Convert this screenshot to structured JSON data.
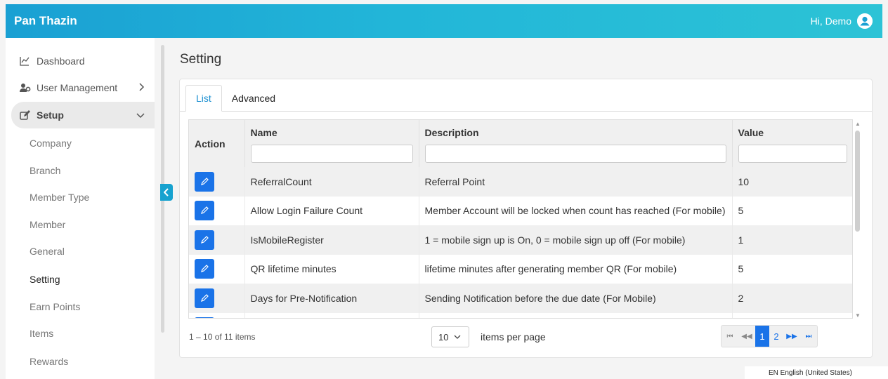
{
  "header": {
    "brand": "Pan Thazin",
    "greeting": "Hi, Demo"
  },
  "sidebar": {
    "items": [
      {
        "label": "Dashboard",
        "icon": "chart-line-icon"
      },
      {
        "label": "User Management",
        "icon": "users-cog-icon"
      },
      {
        "label": "Setup",
        "icon": "edit-icon"
      }
    ],
    "sub_items": [
      "Company",
      "Branch",
      "Member Type",
      "Member",
      "General",
      "Setting",
      "Earn Points",
      "Items",
      "Rewards"
    ],
    "active_sub": "Setting"
  },
  "page": {
    "title": "Setting"
  },
  "tabs": [
    "List",
    "Advanced"
  ],
  "grid": {
    "columns": [
      "Action",
      "Name",
      "Description",
      "Value"
    ],
    "rows": [
      {
        "name": "ReferralCount",
        "description": "Referral Point",
        "value": "10"
      },
      {
        "name": "Allow Login Failure Count",
        "description": "Member Account will be locked when count has reached (For mobile)",
        "value": "5"
      },
      {
        "name": "IsMobileRegister",
        "description": "1 = mobile sign up is On, 0 = mobile sign up off (For mobile)",
        "value": "1"
      },
      {
        "name": "QR lifetime minutes",
        "description": "lifetime minutes after generating member QR (For mobile)",
        "value": "5"
      },
      {
        "name": "Days for Pre-Notification",
        "description": "Sending Notification before the due date (For Mobile)",
        "value": "2"
      }
    ]
  },
  "pager": {
    "info": "1 – 10 of 11 items",
    "page_size": "10",
    "per_page_label": "items per page",
    "pages": [
      "1",
      "2"
    ],
    "current_page": "1"
  },
  "status_bar": {
    "language": "EN English (United States)"
  },
  "colors": {
    "accent": "#1a73e8",
    "header": "#1aa0d3"
  }
}
